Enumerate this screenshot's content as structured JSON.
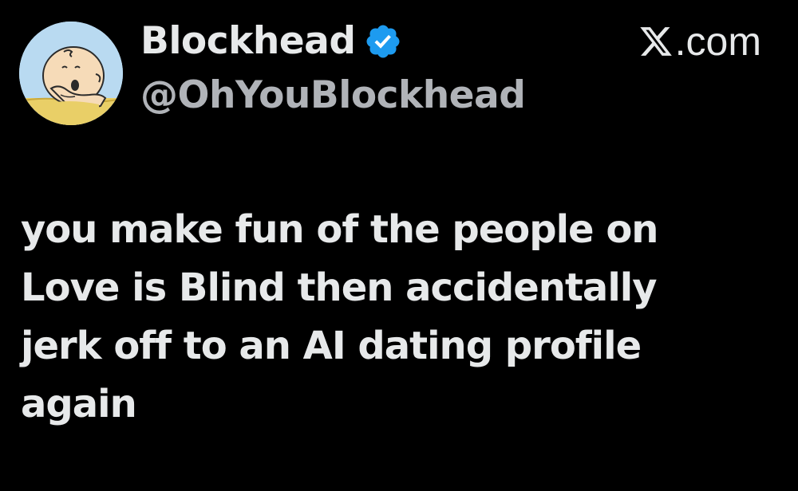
{
  "author": {
    "display_name": "Blockhead",
    "handle": "@OhYouBlockhead",
    "verified": true,
    "avatar_icon": "charlie-brown-avatar"
  },
  "source": {
    "logo_icon": "x-logo-icon",
    "domain_suffix": ".com"
  },
  "tweet": {
    "lines": [
      "you make fun of the people on",
      "Love is Blind then accidentally",
      "jerk off to an AI dating profile",
      "again"
    ]
  },
  "colors": {
    "background": "#000000",
    "text_primary": "#e7e9ea",
    "text_secondary": "#b0b3b8",
    "verified_blue": "#1d9bf0"
  }
}
